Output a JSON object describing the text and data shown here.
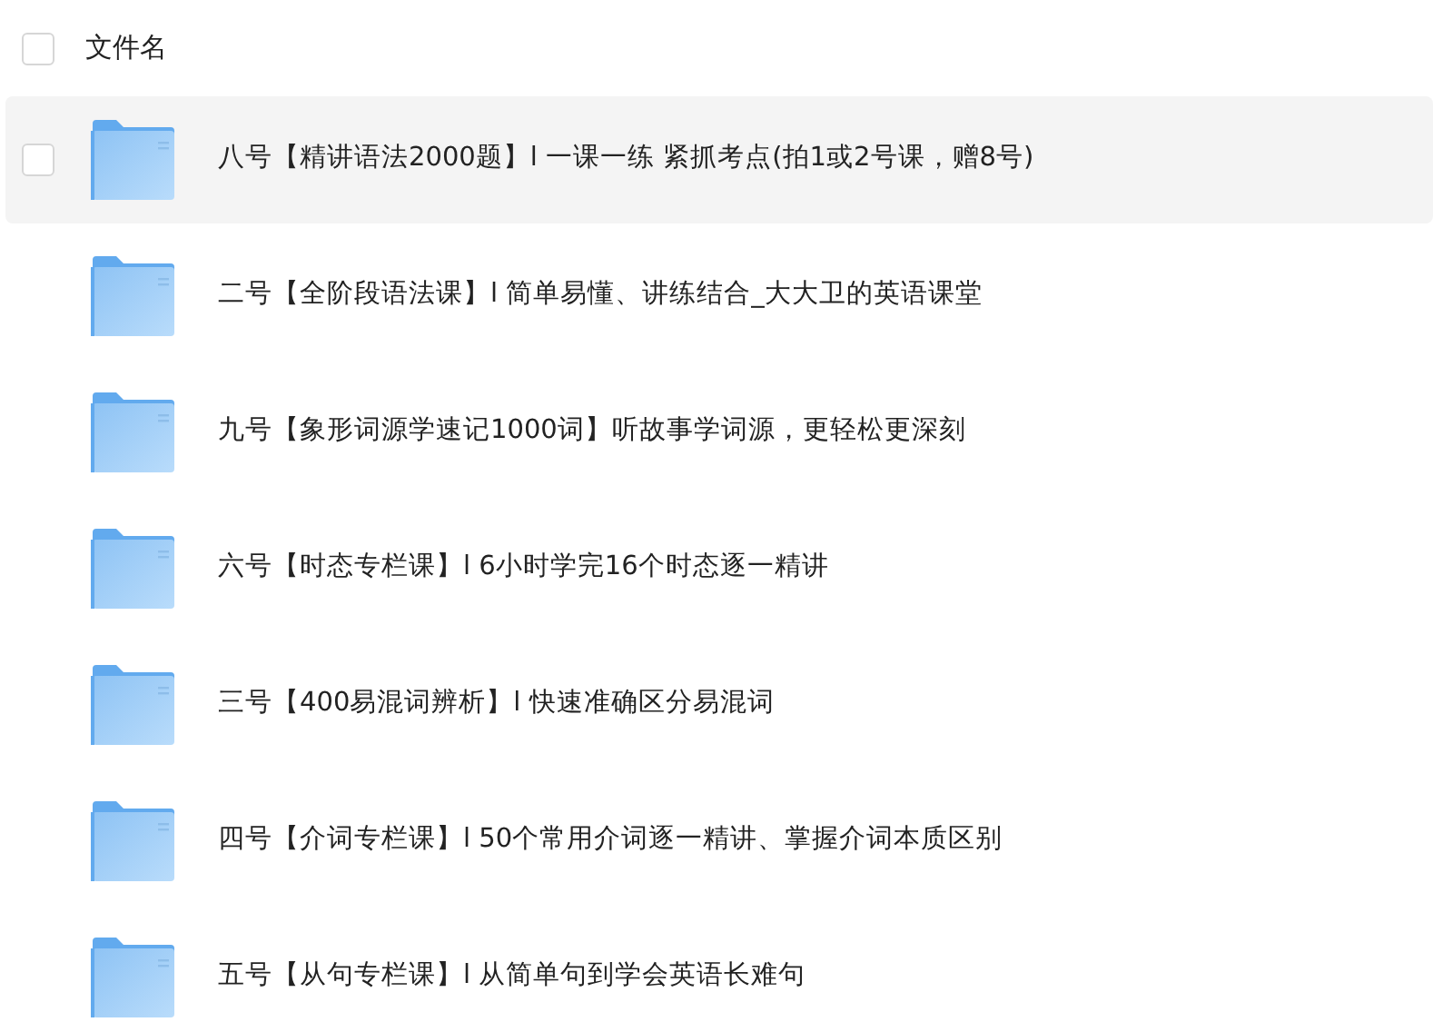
{
  "header": {
    "label": "文件名",
    "checked": false
  },
  "files": [
    {
      "name": "八号【精讲语法2000题】l 一课一练 紧抓考点(拍1或2号课，赠8号)",
      "highlighted": true,
      "checked": false
    },
    {
      "name": "二号【全阶段语法课】l 简单易懂、讲练结合_大大卫的英语课堂",
      "highlighted": false,
      "checked": false
    },
    {
      "name": "九号【象形词源学速记1000词】听故事学词源，更轻松更深刻",
      "highlighted": false,
      "checked": false
    },
    {
      "name": "六号【时态专栏课】l 6小时学完16个时态逐一精讲",
      "highlighted": false,
      "checked": false
    },
    {
      "name": "三号【400易混词辨析】l 快速准确区分易混词",
      "highlighted": false,
      "checked": false
    },
    {
      "name": "四号【介词专栏课】l 50个常用介词逐一精讲、掌握介词本质区别",
      "highlighted": false,
      "checked": false
    },
    {
      "name": "五号【从句专栏课】l 从简单句到学会英语长难句",
      "highlighted": false,
      "checked": false
    }
  ]
}
